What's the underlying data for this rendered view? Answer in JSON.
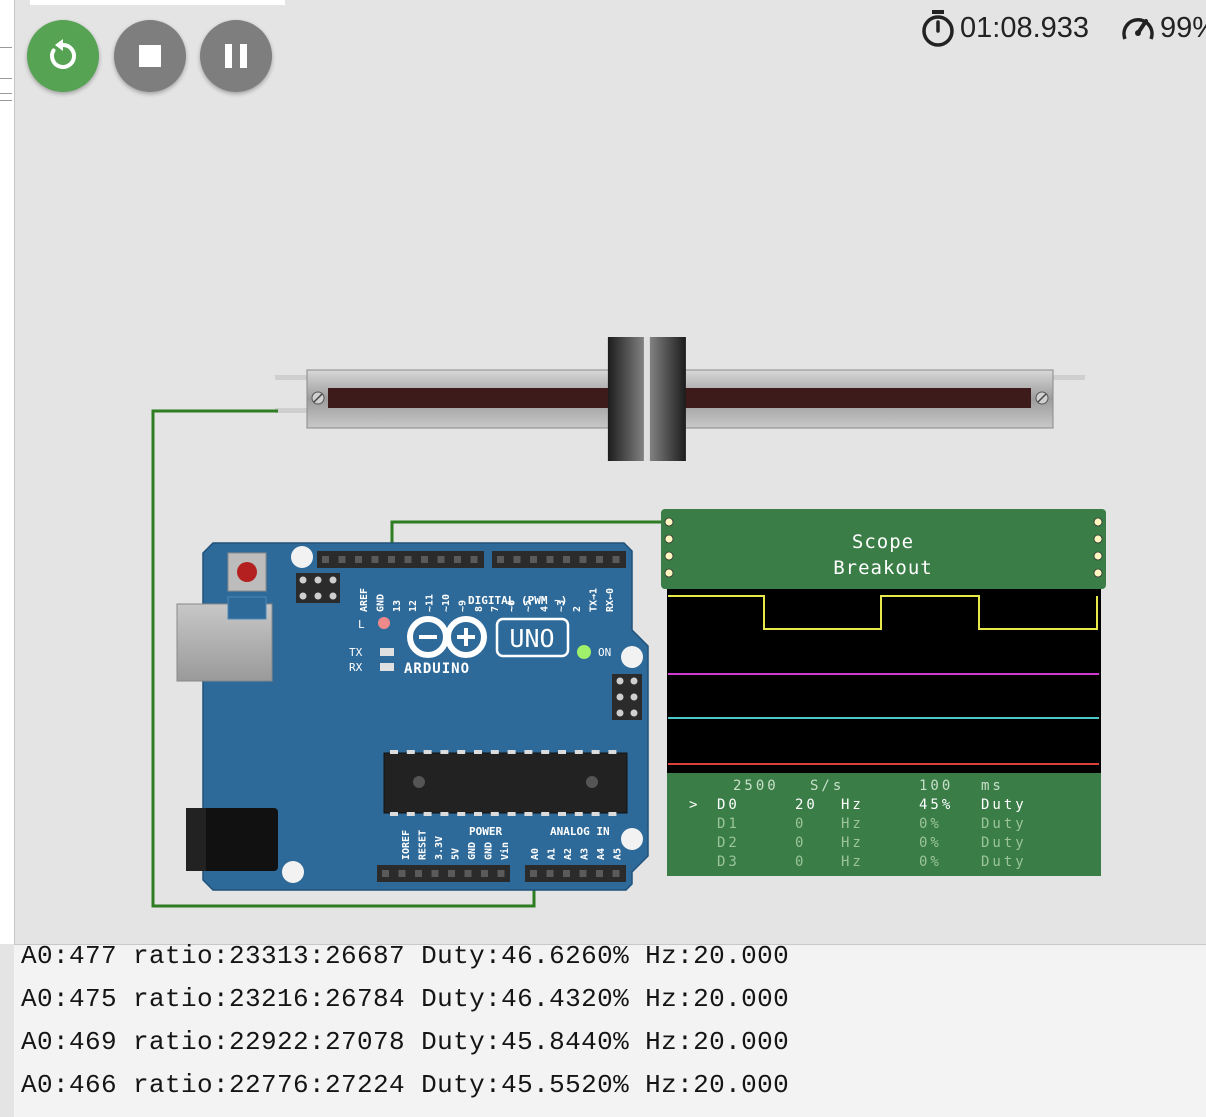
{
  "toolbar": {
    "restart_label": "Restart simulation",
    "stop_label": "Stop simulation",
    "pause_label": "Pause simulation",
    "timer": "01:08.933",
    "speed": "99%"
  },
  "potentiometer": {
    "position_fraction": 0.45
  },
  "arduino": {
    "model": "UNO",
    "brand": "ARDUINO",
    "labels": {
      "digital": "DIGITAL (PWM ~)",
      "power": "POWER",
      "analog": "ANALOG IN",
      "on": "ON",
      "tx": "TX",
      "rx": "RX",
      "l": "L"
    },
    "digital_pins": [
      "AREF",
      "GND",
      "13",
      "12",
      "~11",
      "~10",
      "~9",
      "8",
      "7",
      "~6",
      "~5",
      "4",
      "~3",
      "2",
      "TX→1",
      "RX←0"
    ],
    "power_pins": [
      "IOREF",
      "RESET",
      "3.3V",
      "5V",
      "GND",
      "GND",
      "Vin"
    ],
    "analog_pins": [
      "A0",
      "A1",
      "A2",
      "A3",
      "A4",
      "A5"
    ]
  },
  "scope": {
    "title_line1": "Scope",
    "title_line2": "Breakout",
    "colors": {
      "d0": "#e8e84a",
      "d1": "#d03ad3",
      "d2": "#4bc6c9",
      "d3": "#d8403a"
    },
    "header": {
      "rate": "2500",
      "rate_unit": "S/s",
      "window": "100",
      "window_unit": "ms"
    },
    "channels": [
      {
        "selector": ">",
        "name": "D0",
        "freq": "20",
        "freq_unit": "Hz",
        "duty": "45%",
        "duty_label": "Duty"
      },
      {
        "selector": "",
        "name": "D1",
        "freq": "0",
        "freq_unit": "Hz",
        "duty": "0%",
        "duty_label": "Duty"
      },
      {
        "selector": "",
        "name": "D2",
        "freq": "0",
        "freq_unit": "Hz",
        "duty": "0%",
        "duty_label": "Duty"
      },
      {
        "selector": "",
        "name": "D3",
        "freq": "0",
        "freq_unit": "Hz",
        "duty": "0%",
        "duty_label": "Duty"
      }
    ]
  },
  "serial_monitor": {
    "lines": [
      "A0:477 ratio:23313:26687 Duty:46.6260% Hz:20.000",
      "A0:475 ratio:23216:26784 Duty:46.4320% Hz:20.000",
      "A0:469 ratio:22922:27078 Duty:45.8440% Hz:20.000",
      "A0:466 ratio:22776:27224 Duty:45.5520% Hz:20.000"
    ]
  }
}
